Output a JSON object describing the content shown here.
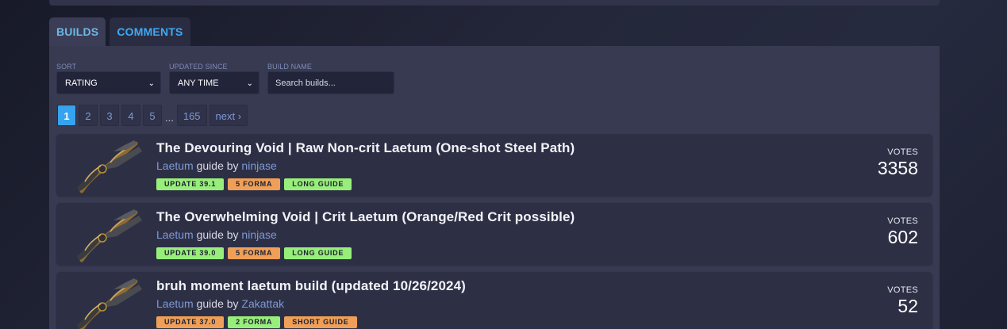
{
  "tabs": [
    {
      "label": "BUILDS",
      "active": true
    },
    {
      "label": "COMMENTS",
      "active": false
    }
  ],
  "filters": {
    "sort": {
      "label": "SORT",
      "value": "RATING"
    },
    "updated_since": {
      "label": "UPDATED SINCE",
      "value": "ANY TIME"
    },
    "build_name": {
      "label": "BUILD NAME",
      "placeholder": "Search builds..."
    }
  },
  "pagination": {
    "pages": [
      "1",
      "2",
      "3",
      "4",
      "5"
    ],
    "current": "1",
    "ellipsis": "...",
    "last": "165",
    "next": "next ›"
  },
  "builds": [
    {
      "title": "The Devouring Void | Raw Non-crit Laetum (One-shot Steel Path)",
      "weapon": "Laetum",
      "guide_by": "guide by",
      "author": "ninjase",
      "tags": [
        {
          "text": "UPDATE 39.1",
          "color": "#98ee7a"
        },
        {
          "text": "5 FORMA",
          "color": "#ef9f57"
        },
        {
          "text": "LONG GUIDE",
          "color": "#98ee7a"
        }
      ],
      "votes_label": "VOTES",
      "votes": "3358"
    },
    {
      "title": "The Overwhelming Void | Crit Laetum (Orange/Red Crit possible)",
      "weapon": "Laetum",
      "guide_by": "guide by",
      "author": "ninjase",
      "tags": [
        {
          "text": "UPDATE 39.0",
          "color": "#98ee7a"
        },
        {
          "text": "5 FORMA",
          "color": "#ef9f57"
        },
        {
          "text": "LONG GUIDE",
          "color": "#98ee7a"
        }
      ],
      "votes_label": "VOTES",
      "votes": "602"
    },
    {
      "title": "bruh moment laetum build (updated 10/26/2024)",
      "weapon": "Laetum",
      "guide_by": "guide by",
      "author": "Zakattak",
      "tags": [
        {
          "text": "UPDATE 37.0",
          "color": "#ef9f57"
        },
        {
          "text": "2 FORMA",
          "color": "#98ee7a"
        },
        {
          "text": "SHORT GUIDE",
          "color": "#ef9f57"
        }
      ],
      "votes_label": "VOTES",
      "votes": "52"
    }
  ],
  "icons": {
    "sort_chevron": "chevron-down-icon",
    "updated_chevron": "chevron-down-icon",
    "weapon_image": "laetum-weapon-image"
  }
}
